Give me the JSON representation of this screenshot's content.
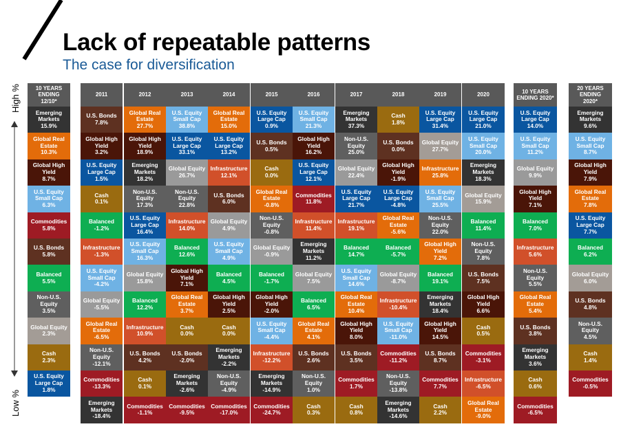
{
  "header": {
    "title": "Lack of repeatable patterns",
    "subtitle": "The case for diversification"
  },
  "axis": {
    "high_label": "High %",
    "low_label": "Low %"
  },
  "colors": {
    "Emerging Markets": "#333333",
    "Global Real Estate": "#e36c0a",
    "Global High Yield": "#4a1508",
    "U.S. Equity Small Cap": "#6fb2e4",
    "Commodities": "#9e1b24",
    "U.S. Bonds": "#5e3121",
    "Balanced": "#0eae52",
    "Non-U.S. Equity": "#5f5f5f",
    "Global Equity": "#9a9a9a",
    "Cash": "#9a6b10",
    "U.S. Equity Large Cap": "#0a56a0",
    "Infrastructure": "#d1502a",
    "header": "#595959"
  },
  "chart_data": {
    "type": "table",
    "title": "Lack of repeatable patterns",
    "subtitle": "The case for diversification",
    "ylabel_top": "High %",
    "ylabel_bottom": "Low %",
    "columns": [
      {
        "header": "10 YEARS ENDING 12/10*",
        "cells": [
          {
            "asset": "Emerging Markets",
            "value": "15.9%"
          },
          {
            "asset": "Global Real Estate",
            "value": "10.3%"
          },
          {
            "asset": "Global High Yield",
            "value": "8.7%"
          },
          {
            "asset": "U.S. Equity Small Cap",
            "value": "6.3%"
          },
          {
            "asset": "Commodities",
            "value": "5.8%"
          },
          {
            "asset": "U.S. Bonds",
            "value": "5.8%"
          },
          {
            "asset": "Balanced",
            "value": "5.5%"
          },
          {
            "asset": "Non-U.S. Equity",
            "value": "3.5%"
          },
          {
            "asset": "Global Equity",
            "value": "2.3%"
          },
          {
            "asset": "Cash",
            "value": "2.3%"
          },
          {
            "asset": "U.S. Equity Large Cap",
            "value": "1.8%"
          }
        ]
      },
      {
        "header": "2011",
        "cells": [
          {
            "asset": "U.S. Bonds",
            "value": "7.8%"
          },
          {
            "asset": "Global High Yield",
            "value": "3.2%"
          },
          {
            "asset": "U.S. Equity Large Cap",
            "value": "1.5%"
          },
          {
            "asset": "Cash",
            "value": "0.1%"
          },
          {
            "asset": "Balanced",
            "value": "-1.2%"
          },
          {
            "asset": "Infrastructure",
            "value": "-1.3%"
          },
          {
            "asset": "U.S. Equity Small Cap",
            "value": "-4.2%"
          },
          {
            "asset": "Global Equity",
            "value": "-5.5%"
          },
          {
            "asset": "Global Real Estate",
            "value": "-6.5%"
          },
          {
            "asset": "Non-U.S. Equity",
            "value": "-12.1%"
          },
          {
            "asset": "Commodities",
            "value": "-13.3%"
          },
          {
            "asset": "Emerging Markets",
            "value": "-18.4%"
          }
        ]
      },
      {
        "header": "2012",
        "cells": [
          {
            "asset": "Global Real Estate",
            "value": "27.7%"
          },
          {
            "asset": "Global High Yield",
            "value": "18.9%"
          },
          {
            "asset": "Emerging Markets",
            "value": "18.2%"
          },
          {
            "asset": "Non-U.S. Equity",
            "value": "17.3%"
          },
          {
            "asset": "U.S. Equity Large Cap",
            "value": "16.4%"
          },
          {
            "asset": "U.S. Equity Small Cap",
            "value": "16.3%"
          },
          {
            "asset": "Global Equity",
            "value": "15.8%"
          },
          {
            "asset": "Balanced",
            "value": "12.2%"
          },
          {
            "asset": "Infrastructure",
            "value": "10.9%"
          },
          {
            "asset": "U.S. Bonds",
            "value": "4.2%"
          },
          {
            "asset": "Cash",
            "value": "0.1%"
          },
          {
            "asset": "Commodities",
            "value": "-1.1%"
          }
        ]
      },
      {
        "header": "2013",
        "cells": [
          {
            "asset": "U.S. Equity Small Cap",
            "value": "38.8%"
          },
          {
            "asset": "U.S. Equity Large Cap",
            "value": "33.1%"
          },
          {
            "asset": "Global Equity",
            "value": "26.7%"
          },
          {
            "asset": "Non-U.S. Equity",
            "value": "22.8%"
          },
          {
            "asset": "Infrastructure",
            "value": "14.0%"
          },
          {
            "asset": "Balanced",
            "value": "12.6%"
          },
          {
            "asset": "Global High Yield",
            "value": "7.1%"
          },
          {
            "asset": "Global Real Estate",
            "value": "3.7%"
          },
          {
            "asset": "Cash",
            "value": "0.0%"
          },
          {
            "asset": "U.S. Bonds",
            "value": "-2.0%"
          },
          {
            "asset": "Emerging Markets",
            "value": "-2.6%"
          },
          {
            "asset": "Commodities",
            "value": "-9.5%"
          }
        ]
      },
      {
        "header": "2014",
        "cells": [
          {
            "asset": "Global Real Estate",
            "value": "15.0%"
          },
          {
            "asset": "U.S. Equity Large Cap",
            "value": "13.2%"
          },
          {
            "asset": "Infrastructure",
            "value": "12.1%"
          },
          {
            "asset": "U.S. Bonds",
            "value": "6.0%"
          },
          {
            "asset": "Global Equity",
            "value": "4.9%"
          },
          {
            "asset": "U.S. Equity Small Cap",
            "value": "4.9%"
          },
          {
            "asset": "Balanced",
            "value": "4.5%"
          },
          {
            "asset": "Global High Yield",
            "value": "2.5%"
          },
          {
            "asset": "Cash",
            "value": "0.0%"
          },
          {
            "asset": "Emerging Markets",
            "value": "-2.2%"
          },
          {
            "asset": "Non-U.S. Equity",
            "value": "-4.9%"
          },
          {
            "asset": "Commodities",
            "value": "-17.0%"
          }
        ]
      },
      {
        "header": "2015",
        "cells": [
          {
            "asset": "U.S. Equity Large Cap",
            "value": "0.9%"
          },
          {
            "asset": "U.S. Bonds",
            "value": "0.5%"
          },
          {
            "asset": "Cash",
            "value": "0.0%"
          },
          {
            "asset": "Global Real Estate",
            "value": "-0.8%"
          },
          {
            "asset": "Non-U.S. Equity",
            "value": "-0.8%"
          },
          {
            "asset": "Global Equity",
            "value": "-0.9%"
          },
          {
            "asset": "Balanced",
            "value": "-1.7%"
          },
          {
            "asset": "Global High Yield",
            "value": "-2.0%"
          },
          {
            "asset": "U.S. Equity Small Cap",
            "value": "-4.4%"
          },
          {
            "asset": "Infrastructure",
            "value": "-12.2%"
          },
          {
            "asset": "Emerging Markets",
            "value": "-14.9%"
          },
          {
            "asset": "Commodities",
            "value": "-24.7%"
          }
        ]
      },
      {
        "header": "2016",
        "cells": [
          {
            "asset": "U.S. Equity Small Cap",
            "value": "21.3%"
          },
          {
            "asset": "Global High Yield",
            "value": "16.2%"
          },
          {
            "asset": "U.S. Equity Large Cap",
            "value": "12.1%"
          },
          {
            "asset": "Commodities",
            "value": "11.8%"
          },
          {
            "asset": "Infrastructure",
            "value": "11.4%"
          },
          {
            "asset": "Emerging Markets",
            "value": "11.2%"
          },
          {
            "asset": "Global Equity",
            "value": "7.5%"
          },
          {
            "asset": "Balanced",
            "value": "6.5%"
          },
          {
            "asset": "Global Real Estate",
            "value": "4.1%"
          },
          {
            "asset": "U.S. Bonds",
            "value": "2.6%"
          },
          {
            "asset": "Non-U.S. Equity",
            "value": "1.0%"
          },
          {
            "asset": "Cash",
            "value": "0.3%"
          }
        ]
      },
      {
        "header": "2017",
        "cells": [
          {
            "asset": "Emerging Markets",
            "value": "37.3%"
          },
          {
            "asset": "Non-U.S. Equity",
            "value": "25.0%"
          },
          {
            "asset": "Global Equity",
            "value": "22.4%"
          },
          {
            "asset": "U.S. Equity Large Cap",
            "value": "21.7%"
          },
          {
            "asset": "Infrastructure",
            "value": "19.1%"
          },
          {
            "asset": "Balanced",
            "value": "14.7%"
          },
          {
            "asset": "U.S. Equity Small Cap",
            "value": "14.6%"
          },
          {
            "asset": "Global Real Estate",
            "value": "10.4%"
          },
          {
            "asset": "Global High Yield",
            "value": "8.0%"
          },
          {
            "asset": "U.S. Bonds",
            "value": "3.5%"
          },
          {
            "asset": "Commodities",
            "value": "1.7%"
          },
          {
            "asset": "Cash",
            "value": "0.8%"
          }
        ]
      },
      {
        "header": "2018",
        "cells": [
          {
            "asset": "Cash",
            "value": "1.8%"
          },
          {
            "asset": "U.S. Bonds",
            "value": "0.0%"
          },
          {
            "asset": "Global High Yield",
            "value": "-1.9%"
          },
          {
            "asset": "U.S. Equity Large Cap",
            "value": "-4.8%"
          },
          {
            "asset": "Global Real Estate",
            "value": "-5.6%"
          },
          {
            "asset": "Balanced",
            "value": "-5.7%"
          },
          {
            "asset": "Global Equity",
            "value": "-8.7%"
          },
          {
            "asset": "Infrastructure",
            "value": "-10.4%"
          },
          {
            "asset": "U.S. Equity Small Cap",
            "value": "-11.0%"
          },
          {
            "asset": "Commodities",
            "value": "-11.2%"
          },
          {
            "asset": "Non-U.S. Equity",
            "value": "-13.8%"
          },
          {
            "asset": "Emerging Markets",
            "value": "-14.6%"
          }
        ]
      },
      {
        "header": "2019",
        "cells": [
          {
            "asset": "U.S. Equity Large Cap",
            "value": "31.4%"
          },
          {
            "asset": "Global Equity",
            "value": "27.7%"
          },
          {
            "asset": "Infrastructure",
            "value": "25.8%",
            "color": "#e36c0a"
          },
          {
            "asset": "U.S. Equity Small Cap",
            "value": "25.5%"
          },
          {
            "asset": "Non-U.S. Equity",
            "value": "22.0%"
          },
          {
            "asset": "Global High Yield",
            "value": "7.2%",
            "color": "#e36c0a"
          },
          {
            "asset": "Balanced",
            "value": "19.1%"
          },
          {
            "asset": "Emerging Markets",
            "value": "18.4%"
          },
          {
            "asset": "Global High Yield",
            "value": "14.5%"
          },
          {
            "asset": "U.S. Bonds",
            "value": "8.7%"
          },
          {
            "asset": "Commodities",
            "value": "7.7%"
          },
          {
            "asset": "Cash",
            "value": "2.2%"
          }
        ]
      },
      {
        "header": "2020",
        "cells": [
          {
            "asset": "U.S. Equity Large Cap",
            "value": "21.0%"
          },
          {
            "asset": "U.S. Equity Small Cap",
            "value": "20.0%"
          },
          {
            "asset": "Emerging Markets",
            "value": "18.3%"
          },
          {
            "asset": "Global Equity",
            "value": "15.9%"
          },
          {
            "asset": "Balanced",
            "value": "11.4%"
          },
          {
            "asset": "Non-U.S. Equity",
            "value": "7.8%"
          },
          {
            "asset": "U.S. Bonds",
            "value": "7.5%"
          },
          {
            "asset": "Global High Yield",
            "value": "6.6%"
          },
          {
            "asset": "Cash",
            "value": "0.5%"
          },
          {
            "asset": "Commodities",
            "value": "-3.1%"
          },
          {
            "asset": "Infrastructure",
            "value": "-6.5%"
          },
          {
            "asset": "Global Real Estate",
            "value": "-9.0%"
          }
        ]
      },
      {
        "header": "10 YEARS ENDING 2020*",
        "cells": [
          {
            "asset": "U.S. Equity Large Cap",
            "value": "14.0%"
          },
          {
            "asset": "U.S. Equity Small Cap",
            "value": "11.2%"
          },
          {
            "asset": "Global Equity",
            "value": "9.9%"
          },
          {
            "asset": "Global High Yield",
            "value": "7.1%"
          },
          {
            "asset": "Balanced",
            "value": "7.0%"
          },
          {
            "asset": "Infrastructure",
            "value": "5.6%"
          },
          {
            "asset": "Non-U.S. Equity",
            "value": "5.5%"
          },
          {
            "asset": "Global Real Estate",
            "value": "5.4%"
          },
          {
            "asset": "U.S. Bonds",
            "value": "3.8%"
          },
          {
            "asset": "Emerging Markets",
            "value": "3.6%"
          },
          {
            "asset": "Cash",
            "value": "0.6%"
          },
          {
            "asset": "Commodities",
            "value": "-6.5%"
          }
        ]
      },
      {
        "header": "20 YEARS ENDING 2020*",
        "cells": [
          {
            "asset": "Emerging Markets",
            "value": "9.6%"
          },
          {
            "asset": "U.S. Equity Small Cap",
            "value": "8.7%"
          },
          {
            "asset": "Global High Yield",
            "value": "7.9%"
          },
          {
            "asset": "Global Real Estate",
            "value": "7.8%"
          },
          {
            "asset": "U.S. Equity Large Cap",
            "value": "7.7%"
          },
          {
            "asset": "Balanced",
            "value": "6.2%"
          },
          {
            "asset": "Global Equity",
            "value": "6.0%"
          },
          {
            "asset": "U.S. Bonds",
            "value": "4.8%"
          },
          {
            "asset": "Non-U.S. Equity",
            "value": "4.5%"
          },
          {
            "asset": "Cash",
            "value": "1.4%"
          },
          {
            "asset": "Commodities",
            "value": "-0.5%"
          }
        ]
      }
    ]
  }
}
